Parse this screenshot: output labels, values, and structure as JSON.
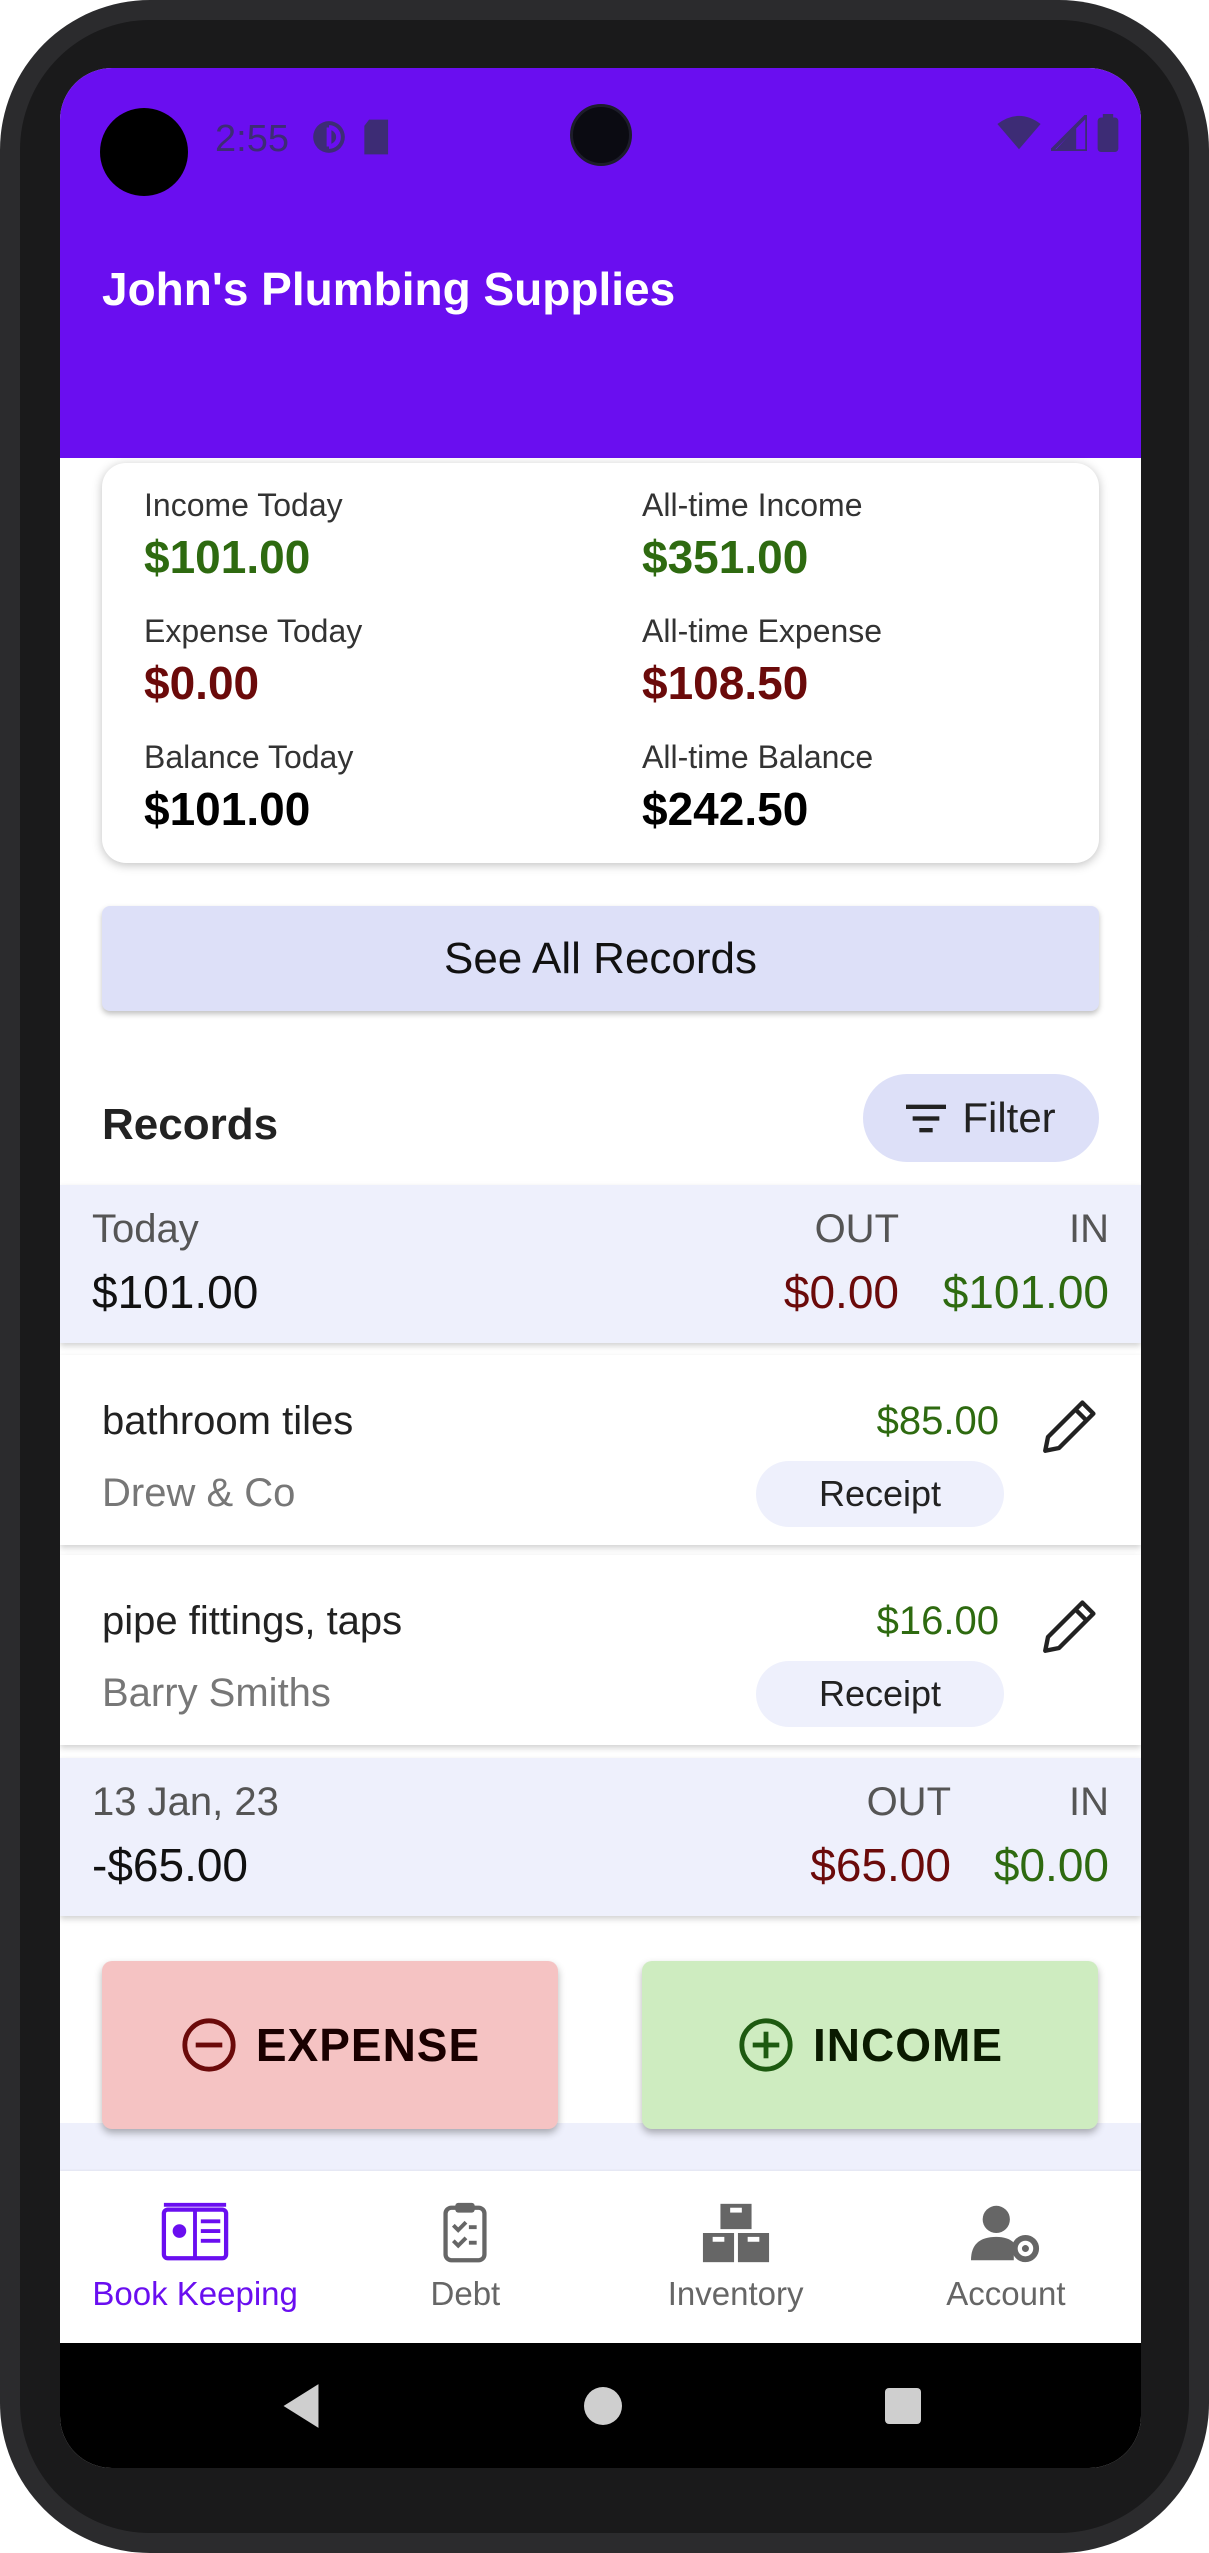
{
  "status_bar": {
    "time": "2:55"
  },
  "app_bar": {
    "title": "John's Plumbing Supplies"
  },
  "summary": {
    "income_today": {
      "label": "Income Today",
      "value": "$101.00"
    },
    "expense_today": {
      "label": "Expense Today",
      "value": "$0.00"
    },
    "balance_today": {
      "label": "Balance Today",
      "value": "$101.00"
    },
    "alltime_income": {
      "label": "All-time Income",
      "value": "$351.00"
    },
    "alltime_expense": {
      "label": "All-time Expense",
      "value": "$108.50"
    },
    "alltime_balance": {
      "label": "All-time Balance",
      "value": "$242.50"
    }
  },
  "see_all_label": "See All Records",
  "records_header": {
    "title": "Records",
    "filter_label": "Filter"
  },
  "groups": [
    {
      "date": "Today",
      "total": "$101.00",
      "out_label": "OUT",
      "in_label": "IN",
      "out_value": "$0.00",
      "in_value": "$101.00",
      "items": [
        {
          "name": "bathroom tiles",
          "party": "Drew & Co",
          "amount": "$85.00",
          "receipt_label": "Receipt"
        },
        {
          "name": "pipe fittings, taps",
          "party": "Barry Smiths",
          "amount": "$16.00",
          "receipt_label": "Receipt"
        }
      ]
    },
    {
      "date": "13 Jan, 23",
      "total": "-$65.00",
      "out_label": "OUT",
      "in_label": "IN",
      "out_value": "$65.00",
      "in_value": "$0.00"
    }
  ],
  "actions": {
    "expense_label": "EXPENSE",
    "income_label": "INCOME"
  },
  "bottom_nav": [
    {
      "label": "Book Keeping",
      "icon": "book-icon",
      "active": true
    },
    {
      "label": "Debt",
      "icon": "clipboard-check-icon",
      "active": false
    },
    {
      "label": "Inventory",
      "icon": "boxes-icon",
      "active": false
    },
    {
      "label": "Account",
      "icon": "user-gear-icon",
      "active": false
    }
  ],
  "colors": {
    "primary": "#6a0ef0",
    "income_green": "#2e6a10",
    "expense_maroon": "#6b0a0a",
    "expense_button": "#f5c3c3",
    "income_button": "#ceecc0"
  }
}
